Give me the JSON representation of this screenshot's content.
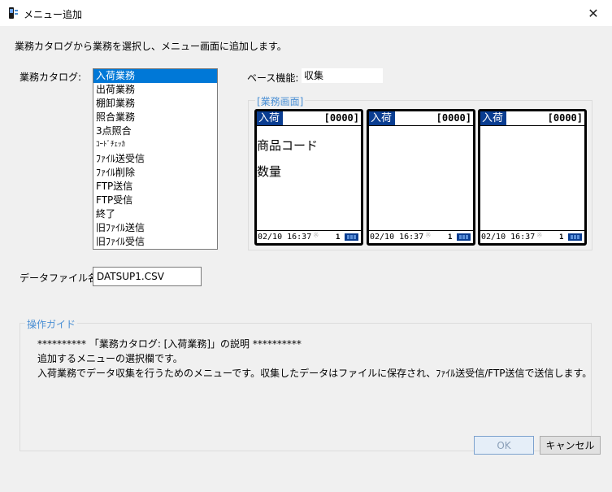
{
  "window": {
    "title": "メニュー追加",
    "close_glyph": "✕"
  },
  "instruction": "業務カタログから業務を選択し、メニュー画面に追加します。",
  "catalog": {
    "label": "業務カタログ:",
    "items": [
      {
        "label": "入荷業務",
        "selected": true
      },
      {
        "label": "出荷業務"
      },
      {
        "label": "棚卸業務"
      },
      {
        "label": "照合業務"
      },
      {
        "label": "3点照合"
      },
      {
        "label": "ｺｰﾄﾞﾁｪｯｶ",
        "small": true
      },
      {
        "label": "ﾌｧｲﾙ送受信"
      },
      {
        "label": "ﾌｧｲﾙ削除"
      },
      {
        "label": "FTP送信"
      },
      {
        "label": "FTP受信"
      },
      {
        "label": "終了"
      },
      {
        "label": "旧ﾌｧｲﾙ送信"
      },
      {
        "label": "旧ﾌｧｲﾙ受信"
      }
    ]
  },
  "base_function": {
    "label": "ベース機能:",
    "value": "収集"
  },
  "screens": {
    "legend": "[業務画面]",
    "devices": [
      {
        "title": "入荷",
        "code": "[0000]",
        "lines": [
          "商品コード",
          "数量"
        ],
        "time": "02/10 16:37",
        "signal": "※",
        "page": "1"
      },
      {
        "title": "入荷",
        "code": "[0000]",
        "lines": [],
        "time": "02/10 16:37",
        "signal": "※",
        "page": "1"
      },
      {
        "title": "入荷",
        "code": "[0000]",
        "lines": [],
        "time": "02/10 16:37",
        "signal": "※",
        "page": "1"
      }
    ]
  },
  "data_file": {
    "label": "データファイル名:",
    "value": "DATSUP1.CSV"
  },
  "guide": {
    "legend": "操作ガイド",
    "lines": [
      "********** 「業務カタログ: [入荷業務]」の説明 **********",
      "追加するメニューの選択欄です。",
      "入荷業務でデータ収集を行うためのメニューです。収集したデータはファイルに保存され、ﾌｧｲﾙ送受信/FTP送信で送信します。"
    ]
  },
  "buttons": {
    "ok": "OK",
    "cancel": "キャンセル"
  },
  "colors": {
    "selection": "#0078d7",
    "device_title_bg": "#0a3d91",
    "legend_text": "#4a8fd4"
  }
}
